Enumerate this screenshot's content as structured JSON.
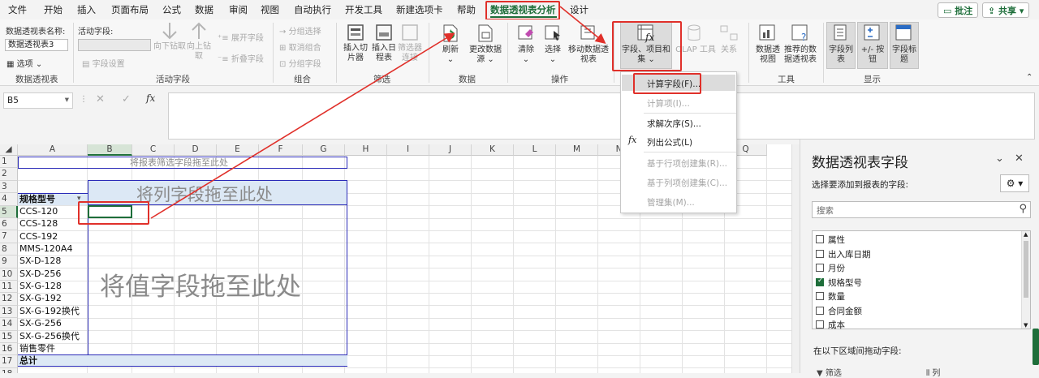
{
  "menu": [
    "文件",
    "开始",
    "插入",
    "页面布局",
    "公式",
    "数据",
    "审阅",
    "视图",
    "自动执行",
    "开发工具",
    "新建选项卡",
    "帮助",
    "数据透视表分析",
    "设计"
  ],
  "topbuttons": {
    "comment": "批注",
    "share": "共享"
  },
  "ribbon": {
    "pivot_name_label": "数据透视表名称:",
    "pivot_name_value": "数据透视表3",
    "options": "选项",
    "group_pivot": "数据透视表",
    "active_field_label": "活动字段:",
    "field_settings": "字段设置",
    "drill_down": "向下钻取",
    "drill_up": "向上钻取",
    "expand": "展开字段",
    "collapse": "折叠字段",
    "group_active": "活动字段",
    "group_sel": "分组选择",
    "ungroup": "取消组合",
    "group_field": "分组字段",
    "group_combine": "组合",
    "slicer": "插入切片器",
    "timeline": "插入日程表",
    "filter_conn": "筛选器连接",
    "group_filter": "筛选",
    "refresh": "刷新",
    "change_source": "更改数据源",
    "group_data": "数据",
    "clear": "清除",
    "select": "选择",
    "move": "移动数据透视表",
    "group_ops": "操作",
    "fields_items": "字段、项目和集",
    "olap": "OLAP 工具",
    "relations": "关系",
    "pivot_chart": "数据透视图",
    "recommended": "推荐的数据透视表",
    "group_tools": "工具",
    "field_list": "字段列表",
    "buttons": "+/- 按钮",
    "field_headers": "字段标题",
    "group_show": "显示"
  },
  "formula": {
    "namebox": "B5",
    "fx": "fx"
  },
  "columns": [
    "A",
    "B",
    "C",
    "D",
    "E",
    "F",
    "G",
    "H",
    "I",
    "J",
    "K",
    "L",
    "M",
    "N",
    "O",
    "P",
    "Q"
  ],
  "rows": [
    "1",
    "2",
    "3",
    "4",
    "5",
    "6",
    "7",
    "8",
    "9",
    "10",
    "11",
    "12",
    "13",
    "14",
    "15",
    "16",
    "17",
    "18"
  ],
  "pivot": {
    "filter_hint": "将报表筛选字段拖至此处",
    "column_hint": "将列字段拖至此处",
    "value_hint": "将值字段拖至此处",
    "row_header": "规格型号",
    "total": "总计",
    "items": [
      "CCS-120",
      "CCS-128",
      "CCS-192",
      "MMS-120A4",
      "SX-D-128",
      "SX-D-256",
      "SX-G-128",
      "SX-G-192",
      "SX-G-192换代",
      "SX-G-256",
      "SX-G-256换代",
      "销售零件"
    ]
  },
  "dropdown": [
    "计算字段(F)...",
    "计算项(I)...",
    "求解次序(S)...",
    "列出公式(L)",
    "基于行项创建集(R)...",
    "基于列项创建集(C)...",
    "管理集(M)..."
  ],
  "pane": {
    "title": "数据透视表字段",
    "subtitle": "选择要添加到报表的字段:",
    "search": "搜索",
    "areas_label": "在以下区域间拖动字段:",
    "filter_area": "筛选",
    "column_area": "列",
    "fields": [
      {
        "name": "属性",
        "checked": false
      },
      {
        "name": "出入库日期",
        "checked": false
      },
      {
        "name": "月份",
        "checked": false
      },
      {
        "name": "规格型号",
        "checked": true
      },
      {
        "name": "数量",
        "checked": false
      },
      {
        "name": "合同金额",
        "checked": false
      },
      {
        "name": "成本",
        "checked": false
      }
    ]
  },
  "colors": {
    "accent": "#1e6e3a",
    "annotation": "#e0302a",
    "pivot_border": "#2b2bb8",
    "pivot_fill": "#dce8f5"
  }
}
